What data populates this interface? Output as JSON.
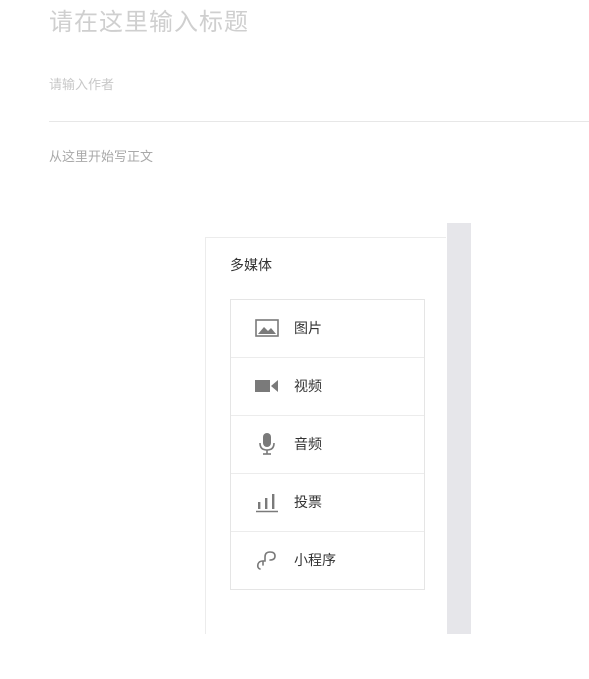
{
  "editor": {
    "title_placeholder": "请在这里输入标题",
    "author_placeholder": "请输入作者",
    "body_placeholder": "从这里开始写正文"
  },
  "media_panel": {
    "title": "多媒体",
    "items": [
      {
        "label": "图片",
        "icon": "image-icon"
      },
      {
        "label": "视频",
        "icon": "video-icon"
      },
      {
        "label": "音频",
        "icon": "microphone-icon"
      },
      {
        "label": "投票",
        "icon": "poll-icon"
      },
      {
        "label": "小程序",
        "icon": "mini-program-icon"
      }
    ]
  },
  "colors": {
    "icon": "#7a7a7a",
    "text": "#333333",
    "placeholder": "#cfcfcf",
    "scrollbar_track": "#e6e6ea"
  }
}
